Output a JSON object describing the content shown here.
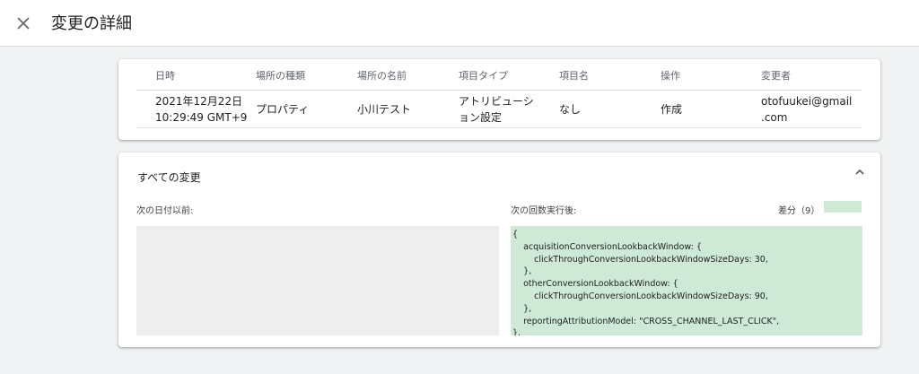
{
  "header": {
    "title": "変更の詳細",
    "close_icon": "close-icon"
  },
  "table": {
    "headers": [
      "日時",
      "場所の種類",
      "場所の名前",
      "項目タイプ",
      "項目名",
      "操作",
      "変更者"
    ],
    "row": {
      "datetime_line1": "2021年12月22日",
      "datetime_line2": "10:29:49 GMT+9",
      "location_type": "プロパティ",
      "location_name": "小川テスト",
      "item_type_line1": "アトリビューシ",
      "item_type_line2": "ョン設定",
      "item_name": "なし",
      "operation": "作成",
      "changed_by_line1": "otofuukei@gmail",
      "changed_by_line2": ".com"
    }
  },
  "changes": {
    "title": "すべての変更",
    "before_label": "次の日付以前:",
    "after_label": "次の回数実行後:",
    "diff_label": "差分（9）",
    "diff_color": "#ceead6",
    "after_lines": [
      "{",
      "    acquisitionConversionLookbackWindow: {",
      "        clickThroughConversionLookbackWindowSizeDays: 30,",
      "    },",
      "    otherConversionLookbackWindow: {",
      "        clickThroughConversionLookbackWindowSizeDays: 90,",
      "    },",
      "    reportingAttributionModel: \"CROSS_CHANNEL_LAST_CLICK\",",
      "},"
    ]
  }
}
